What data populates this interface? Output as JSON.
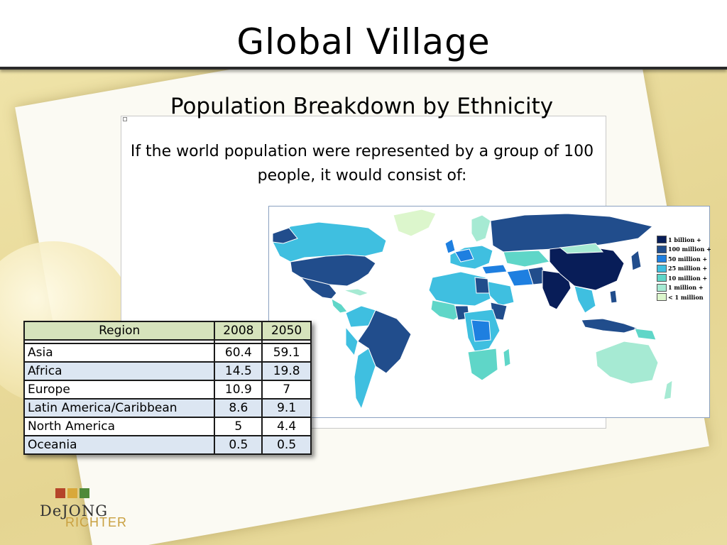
{
  "slide": {
    "title": "Global Village",
    "subtitle": "Population Breakdown by Ethnicity",
    "intro": "If the world population were represented by a group of 100 people, it would consist of:"
  },
  "map": {
    "legend": [
      {
        "label": "1 billion +",
        "color": "#081d58"
      },
      {
        "label": "100 million +",
        "color": "#214d8c"
      },
      {
        "label": "50 million +",
        "color": "#1e7fe0"
      },
      {
        "label": "25 million +",
        "color": "#3fbfe0"
      },
      {
        "label": "10 million +",
        "color": "#5fd6c8"
      },
      {
        "label": "1 million +",
        "color": "#a6ead3"
      },
      {
        "label": "< 1 million",
        "color": "#dcf6cc"
      }
    ]
  },
  "table": {
    "headers": [
      "Region",
      "2008",
      "2050"
    ],
    "rows": [
      {
        "region": "Asia",
        "y2008": "60.4",
        "y2050": "59.1"
      },
      {
        "region": "Africa",
        "y2008": "14.5",
        "y2050": "19.8"
      },
      {
        "region": "Europe",
        "y2008": "10.9",
        "y2050": "7"
      },
      {
        "region": "Latin America/Caribbean",
        "y2008": "8.6",
        "y2050": "9.1"
      },
      {
        "region": "North America",
        "y2008": "5",
        "y2050": "4.4"
      },
      {
        "region": "Oceania",
        "y2008": "0.5",
        "y2050": "0.5"
      }
    ]
  },
  "logo": {
    "line1": "DeJONG",
    "line2": "RICHTER",
    "colors": [
      "#b5452a",
      "#d9a83a",
      "#4f8a3a"
    ]
  }
}
